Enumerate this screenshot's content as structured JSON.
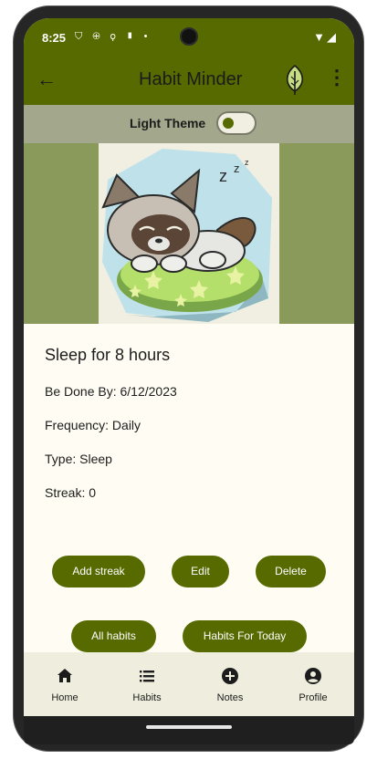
{
  "status_bar": {
    "time": "8:25",
    "icons": "⛉ ⊕ ⚲ ▮ •",
    "right_icons": "▼◢"
  },
  "app_bar": {
    "title": "Habit Minder",
    "back_icon": "arrow-left-icon",
    "leaf_icon": "leaf-icon",
    "more_icon": "more-vert-icon"
  },
  "theme": {
    "label": "Light Theme",
    "enabled": false
  },
  "habit": {
    "title": "Sleep for 8 hours",
    "due": "Be Done By: 6/12/2023",
    "frequency": "Frequency: Daily",
    "type": "Type: Sleep",
    "streak": "Streak: 0"
  },
  "actions": {
    "add_streak": "Add streak",
    "edit": "Edit",
    "delete": "Delete",
    "all_habits": "All habits",
    "habits_today": "Habits For Today"
  },
  "nav": [
    {
      "label": "Home",
      "icon": "home-icon"
    },
    {
      "label": "Habits",
      "icon": "list-icon"
    },
    {
      "label": "Notes",
      "icon": "add-circle-icon"
    },
    {
      "label": "Profile",
      "icon": "account-circle-icon"
    }
  ],
  "colors": {
    "primary": "#566a00",
    "theme_bar": "#a3a78b",
    "image_band": "#8a9a5a",
    "background": "#fffcf3",
    "nav_bg": "#efeede"
  }
}
